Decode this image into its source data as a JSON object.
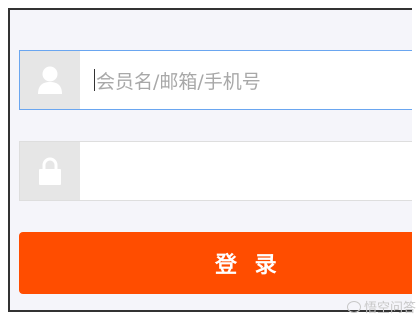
{
  "login": {
    "username_placeholder": "会员名/邮箱/手机号",
    "password_value": "",
    "submit_label": "登 录"
  },
  "watermark": {
    "text": "悟空问答"
  },
  "colors": {
    "accent": "#ff4d00",
    "focus_border": "#6aa6f0",
    "icon_bg": "#e6e6e6",
    "page_bg": "#f5f5fa"
  },
  "icons": {
    "username": "user-icon",
    "password": "lock-icon"
  }
}
